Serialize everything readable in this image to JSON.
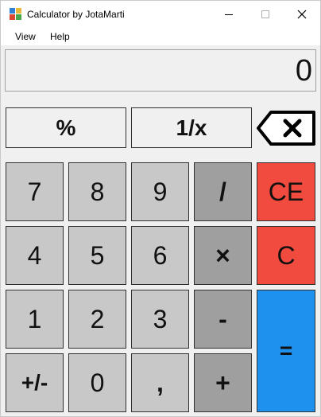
{
  "window": {
    "title": "Calculator by JotaMarti"
  },
  "menu": {
    "view": "View",
    "help": "Help"
  },
  "display": {
    "value": "0"
  },
  "buttons": {
    "percent": "%",
    "reciprocal": "1/x",
    "seven": "7",
    "eight": "8",
    "nine": "9",
    "divide": "/",
    "ce": "CE",
    "four": "4",
    "five": "5",
    "six": "6",
    "multiply": "×",
    "clear": "C",
    "one": "1",
    "two": "2",
    "three": "3",
    "subtract": "-",
    "equals": "=",
    "negate": "+/-",
    "zero": "0",
    "comma": ",",
    "add": "+"
  },
  "icons": {
    "app": "calculator-app-icon",
    "minimize": "minimize-icon",
    "maximize": "maximize-icon",
    "close": "close-icon",
    "backspace": "backspace-icon"
  },
  "colors": {
    "digit": "#c8c8c8",
    "operator": "#9f9f9f",
    "function": "#f0f0f0",
    "clear": "#f14a3e",
    "equals": "#1e90ee"
  }
}
